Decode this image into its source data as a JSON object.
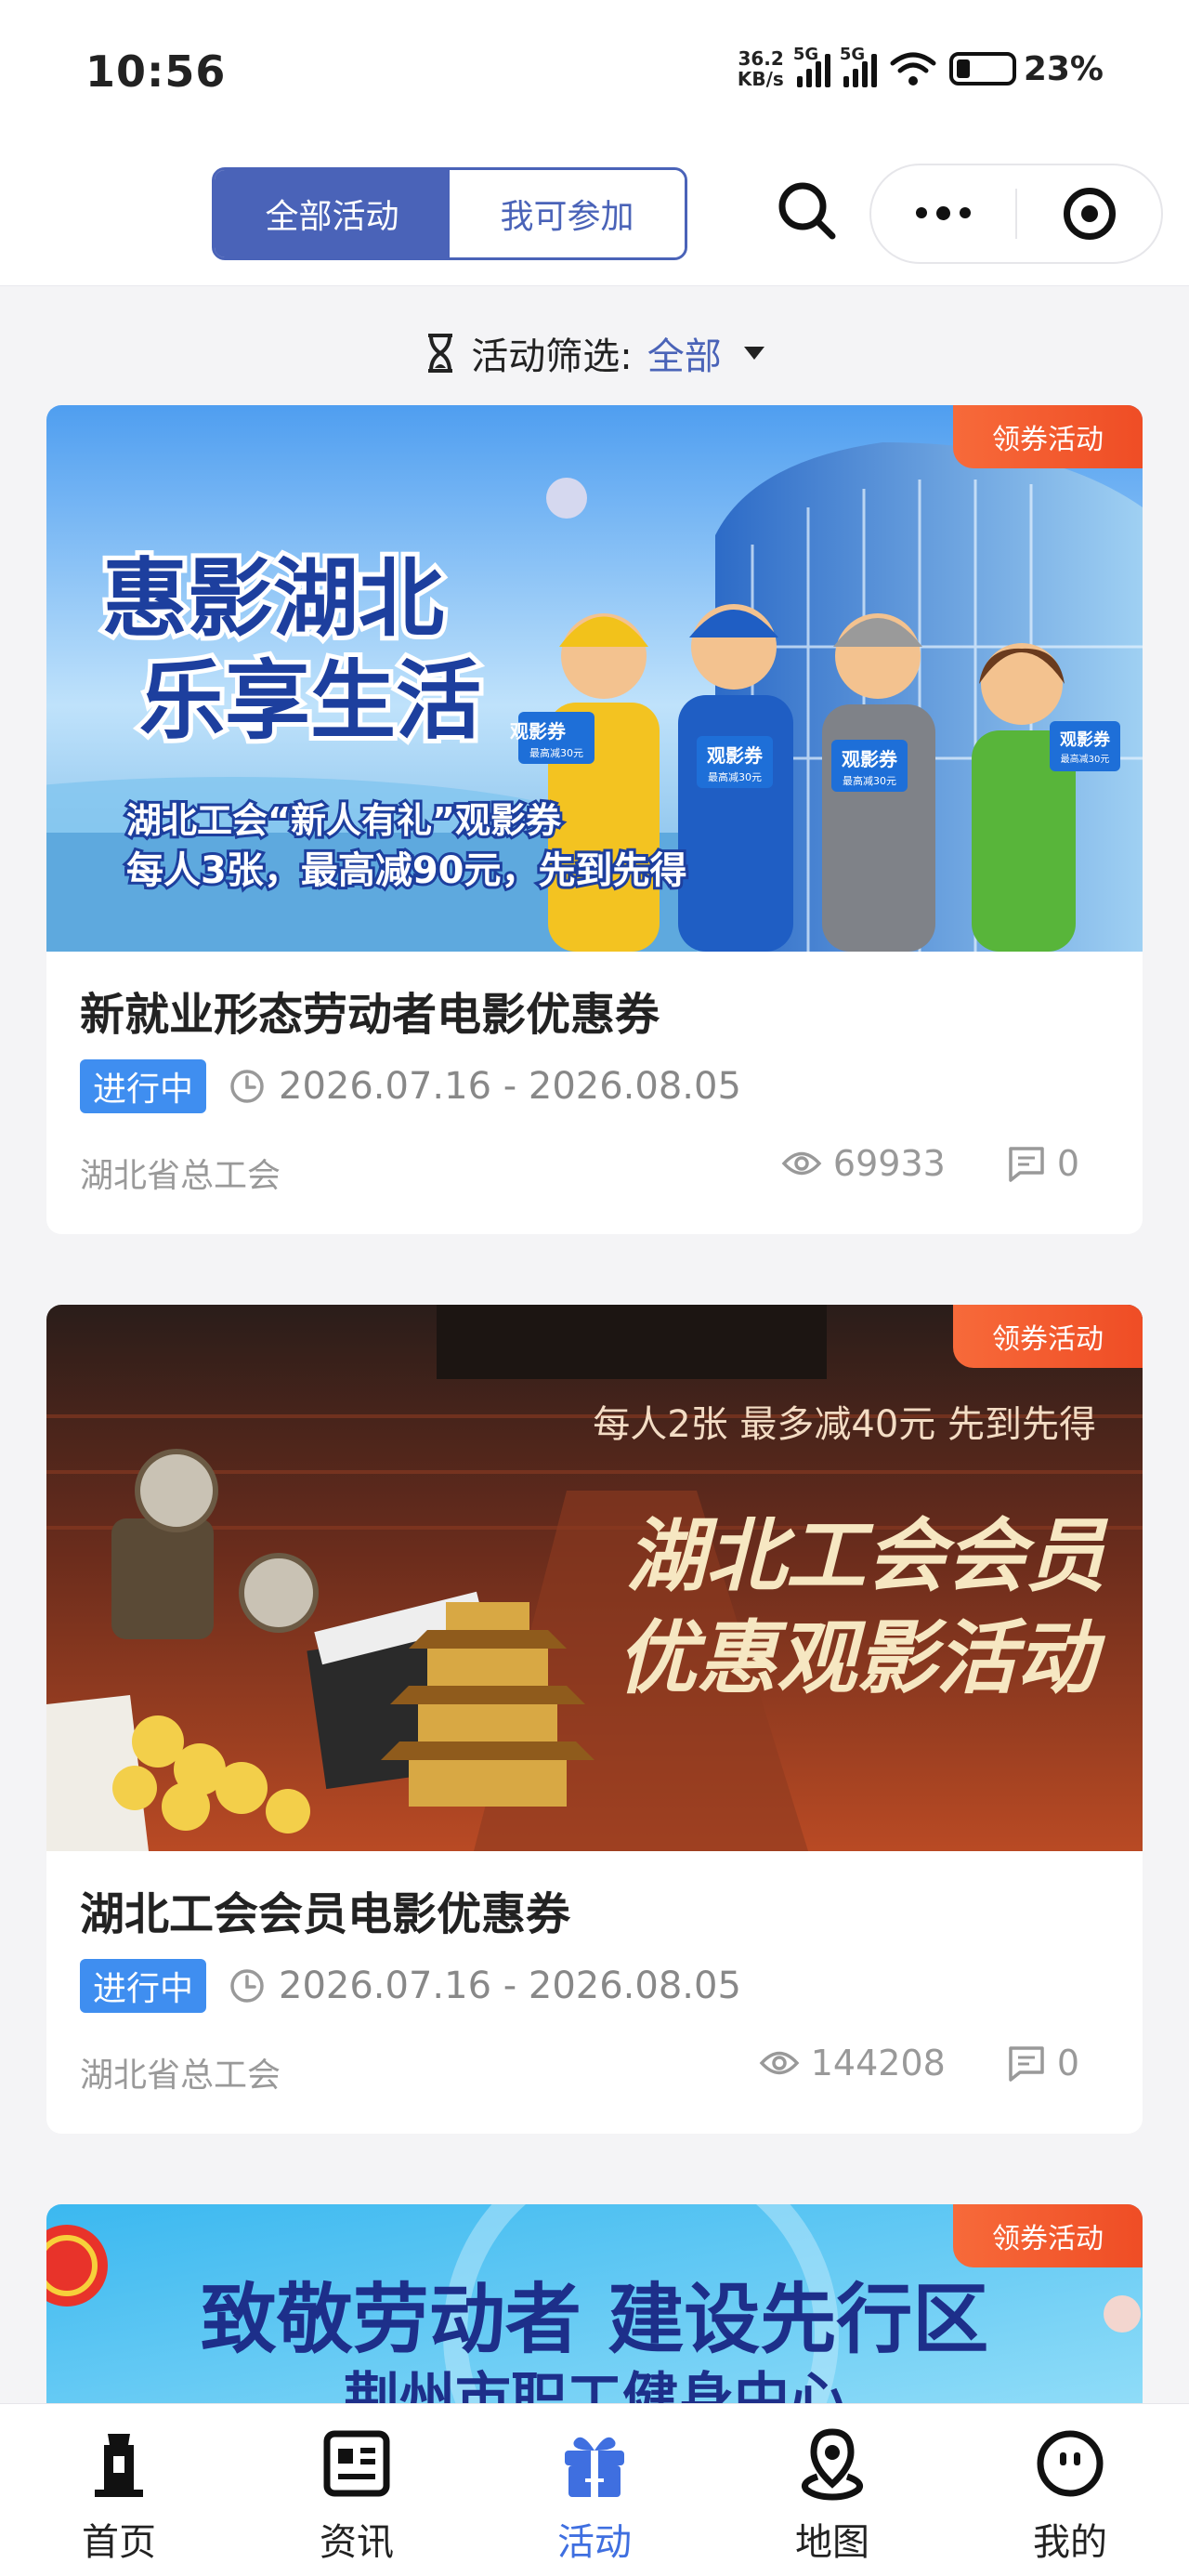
{
  "status_bar": {
    "time": "10:56",
    "net_speed_value": "36.2",
    "net_speed_unit": "KB/s",
    "network_1": "5G",
    "network_2": "5G",
    "battery": "23%"
  },
  "header": {
    "tabs": [
      {
        "label": "全部活动",
        "active": true
      },
      {
        "label": "我可参加",
        "active": false
      }
    ]
  },
  "filter": {
    "label": "活动筛选:",
    "value": "全部"
  },
  "activities": [
    {
      "badge": "领券活动",
      "title": "新就业形态劳动者电影优惠券",
      "status": "进行中",
      "date_range": "2026.07.16 - 2026.08.05",
      "org": "湖北省总工会",
      "views": "69933",
      "comments": "0",
      "banner": {
        "headline_1": "惠影湖北",
        "headline_2": "乐享生活",
        "sub_1": "湖北工会“新人有礼”观影券",
        "sub_2": "每人3张，最高减90元，先到先得",
        "ticket_label": "观影券",
        "ticket_sub": "最高减30元"
      }
    },
    {
      "badge": "领券活动",
      "title": "湖北工会会员电影优惠券",
      "status": "进行中",
      "date_range": "2026.07.16 - 2026.08.05",
      "org": "湖北省总工会",
      "views": "144208",
      "comments": "0",
      "banner": {
        "top_text": "每人2张 最多减40元 先到先得",
        "headline_1": "湖北工会会员",
        "headline_2": "优惠观影活动"
      }
    },
    {
      "badge": "领券活动",
      "banner": {
        "headline": "致敬劳动者  建设先行区",
        "sub": "荆州市职工健身中心"
      }
    }
  ],
  "tabbar": [
    {
      "label": "首页",
      "icon": "home-tower-icon"
    },
    {
      "label": "资讯",
      "icon": "news-icon"
    },
    {
      "label": "活动",
      "icon": "gift-icon",
      "active": true
    },
    {
      "label": "地图",
      "icon": "map-pin-icon"
    },
    {
      "label": "我的",
      "icon": "profile-face-icon"
    }
  ],
  "colors": {
    "primary": "#4a63b8",
    "status_blue": "#3f8ef0",
    "badge_orange": "#ef4d25",
    "tab_active": "#3f6fe0"
  }
}
